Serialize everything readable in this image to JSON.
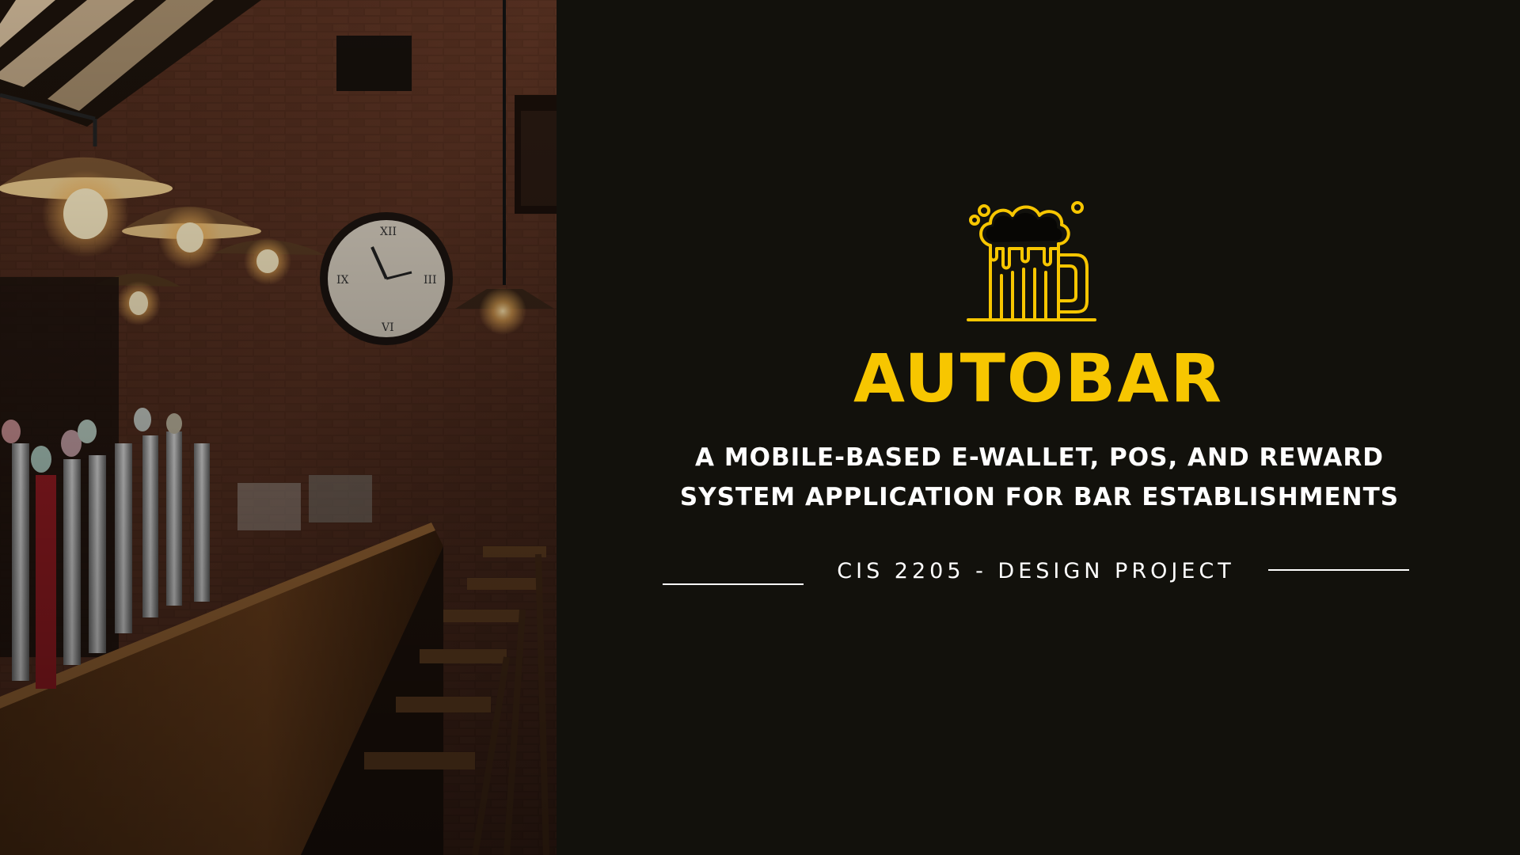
{
  "slide": {
    "title": "AUTOBAR",
    "subtitle_line1": "A MOBILE-BASED E-WALLET, POS, AND REWARD",
    "subtitle_line2": "SYSTEM APPLICATION FOR BAR ESTABLISHMENTS",
    "course": "CIS 2205 - DESIGN PROJECT"
  },
  "icons": {
    "logo": "beer-mug-icon",
    "photo": "bar-interior-photo"
  },
  "colors": {
    "background": "#12110c",
    "accent": "#f7c600",
    "text": "#ffffff"
  }
}
